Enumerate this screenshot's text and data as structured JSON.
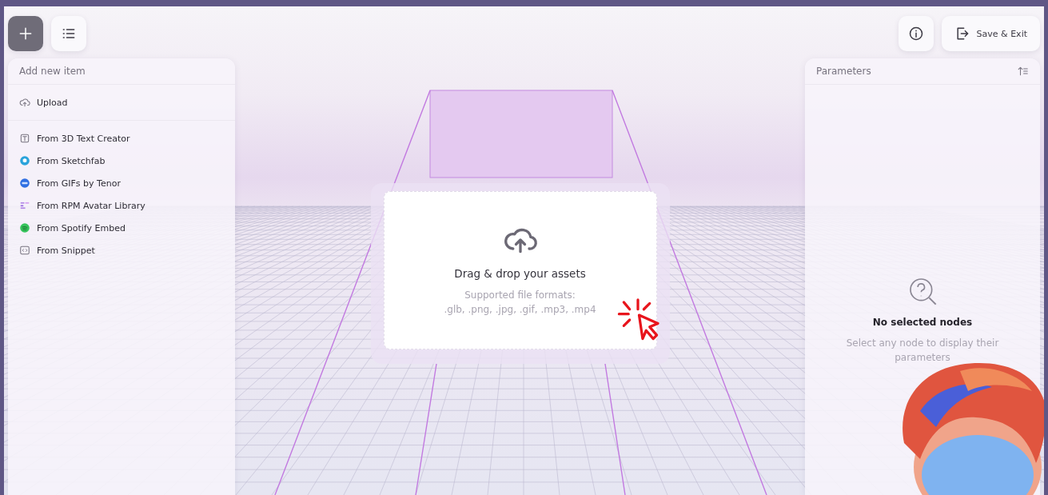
{
  "toolbar": {
    "left_buttons": [
      {
        "kind": "add",
        "selected": true
      },
      {
        "kind": "list",
        "selected": false
      }
    ],
    "right_buttons": [
      {
        "kind": "info"
      },
      {
        "kind": "exit",
        "label": "Save & Exit"
      }
    ]
  },
  "add_panel": {
    "title": "Add new item",
    "sections": [
      {
        "items": [
          {
            "kind": "upload",
            "label": "Upload"
          }
        ]
      },
      {
        "items": [
          {
            "kind": "text",
            "label": "From 3D Text Creator"
          },
          {
            "kind": "sketchfab",
            "label": "From Sketchfab"
          },
          {
            "kind": "gif",
            "label": "From GIFs by Tenor"
          },
          {
            "kind": "avatar",
            "label": "From RPM Avatar Library"
          },
          {
            "kind": "spotify",
            "label": "From Spotify Embed"
          },
          {
            "kind": "snippet",
            "label": "From Snippet"
          }
        ]
      }
    ]
  },
  "drop_zone": {
    "title": "Drag & drop your assets",
    "formats_label": "Supported file formats:",
    "formats": ".glb, .png, .jpg, .gif, .mp3, .mp4"
  },
  "parameters_panel": {
    "title": "Parameters",
    "empty_title": "No selected nodes",
    "empty_text": "Select any node to display their parameters"
  }
}
